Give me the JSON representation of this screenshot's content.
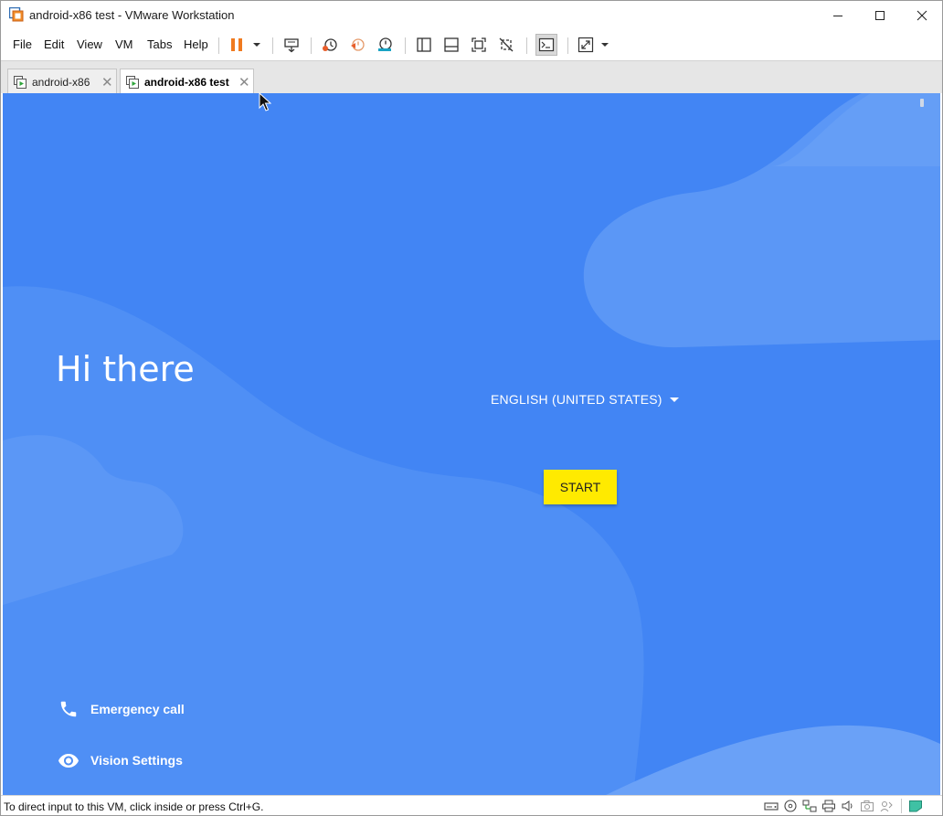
{
  "window": {
    "title": "android-x86 test - VMware Workstation",
    "controls": [
      "minimize-icon",
      "maximize-icon",
      "close-icon"
    ]
  },
  "menu": {
    "items": [
      "File",
      "Edit",
      "View",
      "VM",
      "Tabs",
      "Help"
    ]
  },
  "toolbar": {
    "icons": [
      "pause-icon",
      "dropdown-caret-icon",
      "send-ctrl-alt-del-icon",
      "snapshot-take-icon",
      "snapshot-revert-icon",
      "snapshot-manager-icon",
      "library-view-icon",
      "thumbnail-bar-icon",
      "full-screen-icon",
      "unity-icon",
      "console-view-icon",
      "stretch-guest-icon",
      "dropdown-caret-icon"
    ],
    "accent_pause": "#f07a1f"
  },
  "tabs": [
    {
      "label": "android-x86",
      "active": false
    },
    {
      "label": "android-x86 test",
      "active": true
    }
  ],
  "vm": {
    "bg_color": "#4285f4",
    "greeting": "Hi there",
    "language": "ENGLISH (UNITED STATES)",
    "start_label": "START",
    "start_color": "#ffea00",
    "emergency_label": "Emergency call",
    "vision_label": "Vision Settings"
  },
  "statusbar": {
    "text": "To direct input to this VM, click inside or press Ctrl+G.",
    "icons": [
      "hard-disk-icon",
      "cd-dvd-icon",
      "network-icon",
      "usb-icon",
      "printer-icon",
      "sound-icon",
      "camera-icon",
      "bluetooth-icon",
      "message-icon"
    ]
  }
}
